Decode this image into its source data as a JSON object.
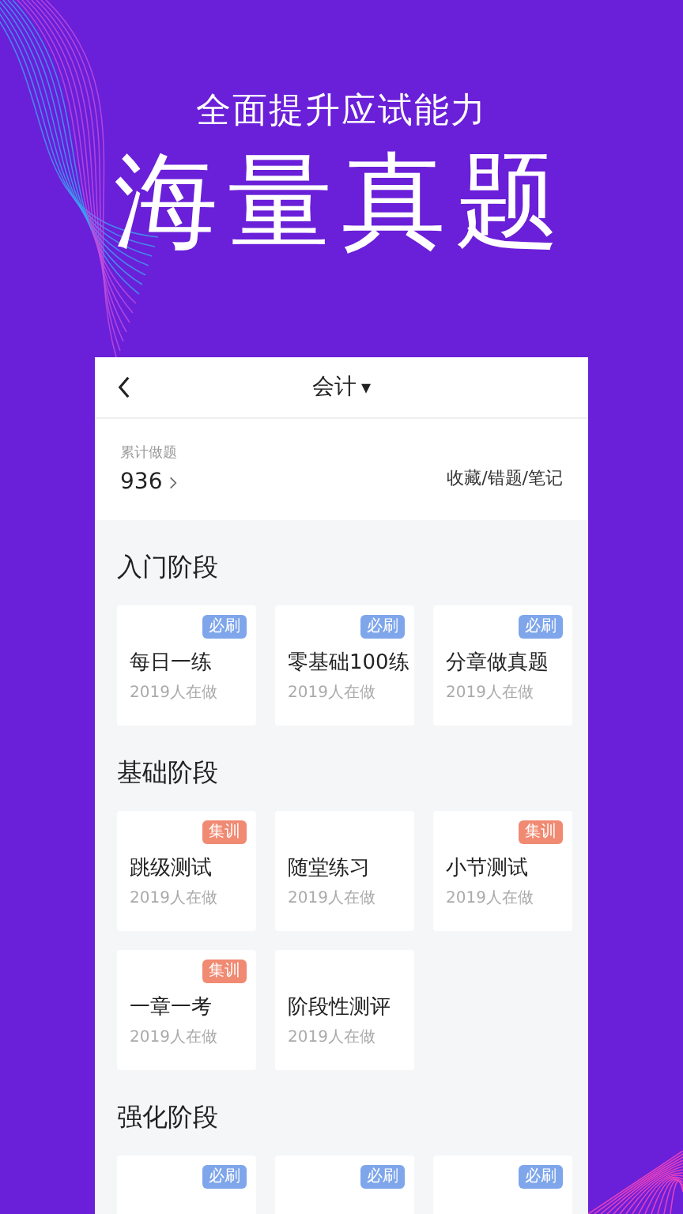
{
  "promo": {
    "subtitle": "全面提升应试能力",
    "title": "海量真题"
  },
  "topbar": {
    "title": "会计",
    "caret": "▾"
  },
  "stats": {
    "label": "累计做题",
    "count": "936",
    "links": "收藏/错题/笔记"
  },
  "sections": [
    {
      "title": "入门阶段",
      "cards": [
        {
          "tag": {
            "text": "必刷",
            "kind": "must"
          },
          "name": "每日一练",
          "people": "2019人在做"
        },
        {
          "tag": {
            "text": "必刷",
            "kind": "must"
          },
          "name": "零基础100练",
          "people": "2019人在做"
        },
        {
          "tag": {
            "text": "必刷",
            "kind": "must"
          },
          "name": "分章做真题",
          "people": "2019人在做"
        }
      ]
    },
    {
      "title": "基础阶段",
      "cards": [
        {
          "tag": {
            "text": "集训",
            "kind": "train"
          },
          "name": "跳级测试",
          "people": "2019人在做"
        },
        {
          "name": "随堂练习",
          "people": "2019人在做"
        },
        {
          "tag": {
            "text": "集训",
            "kind": "train"
          },
          "name": "小节测试",
          "people": "2019人在做"
        },
        {
          "tag": {
            "text": "集训",
            "kind": "train"
          },
          "name": "一章一考",
          "people": "2019人在做"
        },
        {
          "name": "阶段性测评",
          "people": "2019人在做"
        }
      ]
    },
    {
      "title": "强化阶段",
      "cards": [
        {
          "tag": {
            "text": "必刷",
            "kind": "must"
          }
        },
        {
          "tag": {
            "text": "必刷",
            "kind": "must"
          }
        },
        {
          "tag": {
            "text": "必刷",
            "kind": "must"
          }
        }
      ]
    }
  ]
}
